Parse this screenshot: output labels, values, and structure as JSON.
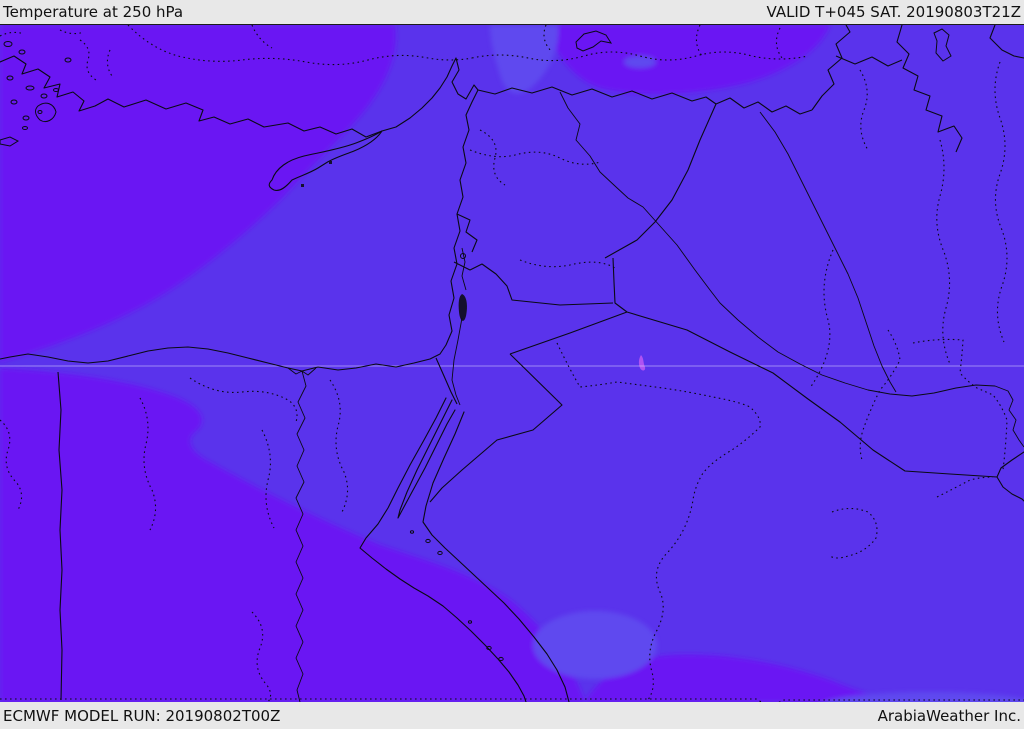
{
  "header": {
    "title": "Temperature at 250 hPa",
    "valid_label": "VALID T+045 SAT. 20190803T21Z"
  },
  "footer": {
    "model_run": "ECMWF MODEL RUN: 20190802T00Z",
    "credit": "ArabiaWeather Inc."
  },
  "map": {
    "type": "weather-temperature-contour-map",
    "region": "Middle East / Eastern Mediterranean",
    "parameter": "Temperature at 250 hPa",
    "colors": {
      "bar-bg": "#e8e8e8",
      "bar-text": "#111111",
      "band-mid": "#5a33ec",
      "band-violet": "#6a15f3",
      "band-light": "#5f48ef",
      "warm-speck": "#b052f2",
      "line": "#0a0a14",
      "gridline": "rgba(228,222,255,0.5)"
    },
    "visible_features": [
      "coastlines",
      "country borders (solid)",
      "administrative boundaries (dotted)",
      "latitude gridline",
      "Cyprus",
      "Nile river",
      "Euphrates and Tigris rivers",
      "Red Sea",
      "Persian Gulf coast",
      "temperature shading bands"
    ]
  }
}
